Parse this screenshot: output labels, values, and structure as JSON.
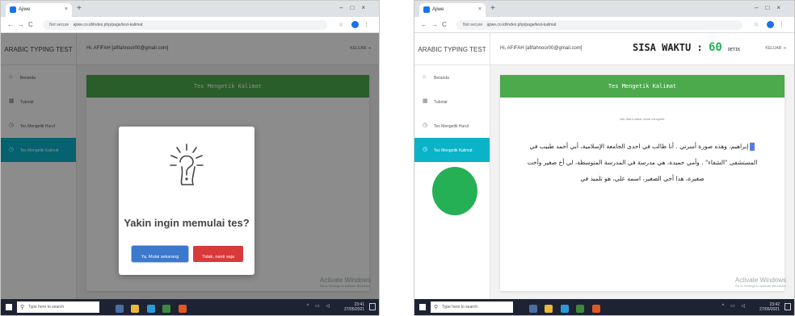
{
  "left": {
    "browser": {
      "tab_title": "Ajiwe",
      "url_warning": "Not secure",
      "url": "ajiwe.co.id/index.php/page/test-kalimat"
    },
    "brand": "ARABIC TYPING TEST",
    "menu": [
      {
        "label": "Beranda"
      },
      {
        "label": "Tutorial"
      },
      {
        "label": "Tes Mengetik Huruf"
      },
      {
        "label": "Tes Mengetik Kalimat"
      }
    ],
    "user": "Hi, AFIFAH [afifahnoor00@gmail.com]",
    "logout_label": "KELUAR",
    "card_title": "Tes Mengetik Kalimat",
    "modal": {
      "title": "Yakin ingin memulai tes?",
      "confirm_label": "Ya, Mulai sekarang",
      "cancel_label": "Tidak, nanti saja"
    },
    "watermark": {
      "line1": "Activate Windows",
      "line2": "Go to Settings to activate Windows."
    },
    "taskbar": {
      "search_placeholder": "Type here to search",
      "time": "23:41",
      "date": "27/05/2021"
    }
  },
  "right": {
    "browser": {
      "tab_title": "Ajiwe",
      "url_warning": "Not secure",
      "url": "ajiwe.co.id/index.php/page/test-kalimat"
    },
    "brand": "ARABIC TYPING TEST",
    "menu": [
      {
        "label": "Beranda"
      },
      {
        "label": "Tutorial"
      },
      {
        "label": "Tes Mengetik Huruf"
      },
      {
        "label": "Tes Mengetik Kalimat"
      }
    ],
    "user": "Hi, AFIFAH [afifahnoor00@gmail.com]",
    "timer": {
      "label": "SISA WAKTU :",
      "value": "60",
      "unit": "DETIK"
    },
    "logout_label": "KELUAR",
    "card_title": "Tes Mengetik Kalimat",
    "hint": "klik disini untuk mulai mengetik",
    "arabic_text": "إبراهيم، وهذه صورة أسرتي . أنا طالب في احدى الجامعة الإسلامية، أبي أحمد طبيب في المستشفى \"الشفاء\" . وأمي حميدة، هي مدرسة في المدرسة المتوسطة، لي أخ صغير وأخت صغيرة، هذا أخي الصغير، اسمه علي، هو تلميذ في",
    "watermark": {
      "line1": "Activate Windows",
      "line2": "Go to Settings to activate Windows."
    },
    "taskbar": {
      "search_placeholder": "Type here to search",
      "time": "23:42",
      "date": "27/05/2021"
    }
  },
  "colors": {
    "header_green": "#4ca94c",
    "active_menu": "#0ab3c8",
    "confirm_blue": "#3c78cc",
    "cancel_red": "#d83a3a",
    "circle_green": "#25b056"
  }
}
